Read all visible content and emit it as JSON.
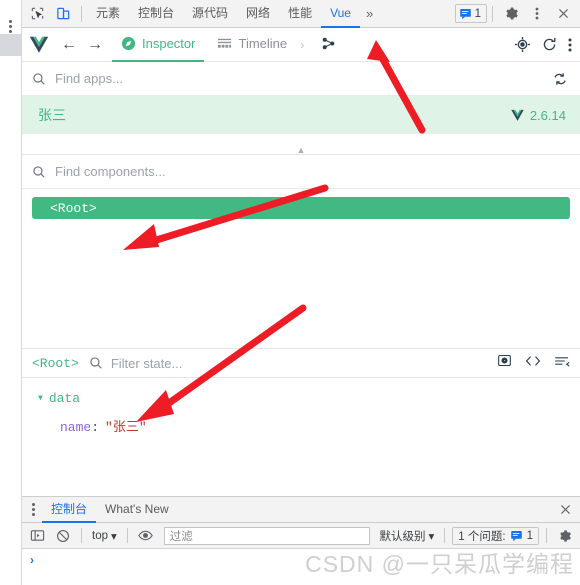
{
  "devtools_bar": {
    "left_icons": [
      {
        "name": "inspect-element-icon",
        "label": "Inspect element"
      },
      {
        "name": "device-toolbar-icon",
        "label": "Toggle device toolbar"
      }
    ],
    "tabs": [
      {
        "label": "元素",
        "active": false
      },
      {
        "label": "控制台",
        "active": false
      },
      {
        "label": "源代码",
        "active": false
      },
      {
        "label": "网络",
        "active": false
      },
      {
        "label": "性能",
        "active": false
      },
      {
        "label": "Vue",
        "active": true
      }
    ],
    "overflow_label": "»",
    "issues_count": "1",
    "right_icons": [
      {
        "name": "settings-gear-icon"
      },
      {
        "name": "more-options-icon"
      },
      {
        "name": "close-devtools-icon"
      }
    ]
  },
  "vue_toolbar": {
    "logo_name": "vue-logo",
    "back_label": "←",
    "forward_label": "→",
    "tabs": [
      {
        "label": "Inspector",
        "icon": "compass-icon",
        "active": true
      },
      {
        "label": "Timeline",
        "icon": "timeline-icon",
        "active": false
      }
    ],
    "chevron": "›",
    "right_icons": [
      {
        "name": "select-component-target-icon"
      },
      {
        "name": "refresh-icon"
      },
      {
        "name": "vue-more-options-icon"
      }
    ]
  },
  "app_search": {
    "placeholder": "Find apps...",
    "refresh_icon": "refresh-apps-icon"
  },
  "apps": [
    {
      "name": "张三",
      "version": "2.6.14",
      "selected": true,
      "accent": "#41b883",
      "row_bg": "#dff3e7"
    }
  ],
  "component_search": {
    "placeholder": "Find components..."
  },
  "component_tree": {
    "nodes": [
      {
        "label": "<Root>",
        "selected": true,
        "color": "#42b883"
      }
    ]
  },
  "state_header": {
    "breadcrumb": "<Root>",
    "filter_placeholder": "Filter state...",
    "icons": [
      {
        "name": "snapshot-camera-icon"
      },
      {
        "name": "code-brackets-icon"
      },
      {
        "name": "sort-filter-icon"
      }
    ]
  },
  "state_body": {
    "groups": [
      {
        "title": "data",
        "expanded": true,
        "fields": [
          {
            "key": "name",
            "colon": ":",
            "value": "\"张三\""
          }
        ]
      }
    ]
  },
  "drawer": {
    "tabs": [
      {
        "label": "控制台",
        "active": true
      },
      {
        "label": "What's New",
        "active": false
      }
    ],
    "close_label": "✕"
  },
  "console_toolbar": {
    "sidebar_icon": "console-sidebar-icon",
    "clear_icon": "clear-console-icon",
    "context_selector": "top",
    "context_caret": "▾",
    "eye_icon": "live-expression-eye-icon",
    "filter_placeholder": "过滤",
    "level_selector": "默认级别",
    "level_caret": "▾",
    "issues_text": "1 个问题:",
    "issues_count": "1",
    "settings_icon": "console-settings-icon"
  },
  "console_output": {
    "prompt": "›",
    "watermark": "CSDN @一只呆瓜学编程"
  },
  "annotations": {
    "arrows": [
      {
        "name": "arrow-to-vue-tab"
      },
      {
        "name": "arrow-to-root-node"
      },
      {
        "name": "arrow-to-name-value"
      }
    ]
  },
  "colors": {
    "vue_green": "#41b883",
    "vue_dark": "#35495e",
    "chrome_blue": "#1a73e8",
    "arrow_red": "#ee1c25"
  }
}
